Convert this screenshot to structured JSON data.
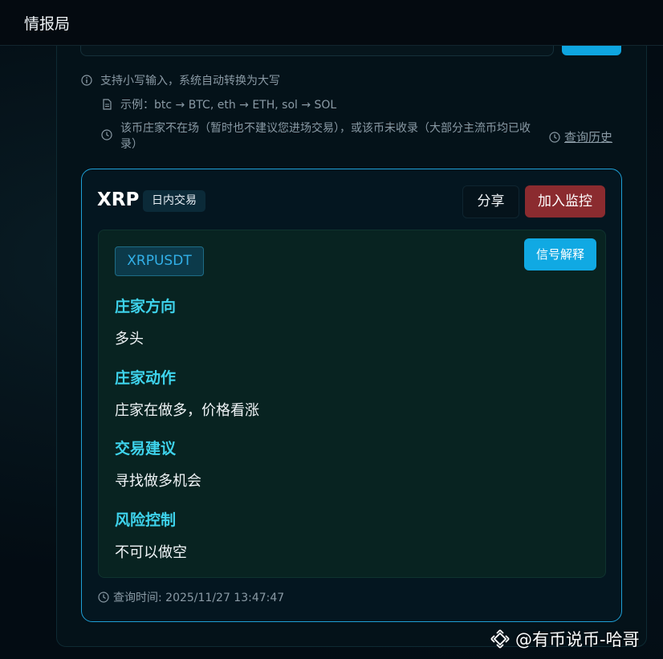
{
  "app": {
    "title": "情报局"
  },
  "search": {
    "value": "",
    "button_label": ""
  },
  "hints": {
    "lowercase": "支持小写输入，系统自动转换为大写",
    "example": "示例：btc → BTC, eth → ETH, sol → SOL",
    "not_listed": "该币庄家不在场（暂时也不建议您进场交易），或该币未收录（大部分主流币均已收录）"
  },
  "history_link": "查询历史",
  "result": {
    "symbol": "XRP",
    "type_badge": "日内交易",
    "share_label": "分享",
    "monitor_label": "加入监控",
    "pair": "XRPUSDT",
    "explain_label": "信号解释",
    "sections": [
      {
        "title": "庄家方向",
        "value": "多头"
      },
      {
        "title": "庄家动作",
        "value": "庄家在做多，价格看涨"
      },
      {
        "title": "交易建议",
        "value": "寻找做多机会"
      },
      {
        "title": "风险控制",
        "value": "不可以做空"
      }
    ],
    "query_time": "查询时间: 2025/11/27 13:47:47"
  },
  "watermark": "@有币说币-哈哥",
  "colors": {
    "accent": "#0ea5e0",
    "section_title": "#3ed3ec",
    "danger_button": "#8b2b2f",
    "pair_tag_text": "#32b0e8"
  },
  "icons": [
    "info-icon",
    "document-icon",
    "clock-icon",
    "logo-icon"
  ]
}
